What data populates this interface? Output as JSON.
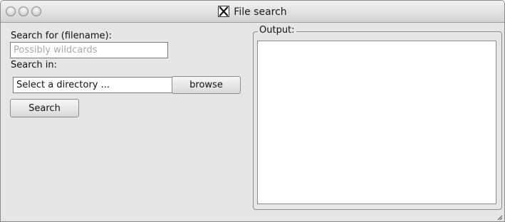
{
  "window": {
    "title": "File search"
  },
  "form": {
    "search_for_label": "Search for (filename):",
    "filename_placeholder": "Possibly wildcards",
    "filename_value": "",
    "search_in_label": "Search in:",
    "directory_value": "Select a directory ...",
    "browse_label": "browse",
    "search_label": "Search"
  },
  "output": {
    "legend": "Output:",
    "content": ""
  },
  "icons": {
    "titlebar_app": "x11-icon",
    "window_controls": [
      "close-icon",
      "minimize-icon",
      "zoom-icon"
    ],
    "resize": "resize-grip-icon"
  }
}
